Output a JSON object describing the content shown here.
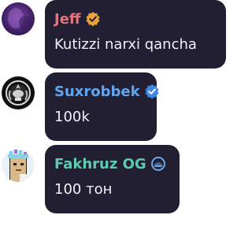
{
  "messages": [
    {
      "sender": "Jeff",
      "sender_color": "#e8737f",
      "badge_icon": "verified-gold-icon",
      "badge_color": "#e9a23b",
      "text": "Kutizzi narxi qancha",
      "avatar": "purple-blur-avatar"
    },
    {
      "sender": "Suxrobbek",
      "sender_color": "#5ea7f0",
      "badge_icon": "verified-blue-icon",
      "badge_color": "#3d8ae6",
      "text": "100k",
      "avatar": "emblem-avatar"
    },
    {
      "sender": "Fakhruz OG",
      "sender_color": "#5ccbb0",
      "badge_icon": "blue-helmet-icon",
      "badge_color": "#6aa7ea",
      "text": "100 тон",
      "avatar": "pixel-punk-avatar"
    }
  ],
  "colors": {
    "bubble_bg": "#231f32",
    "text": "#f2f2f7",
    "page_bg": "#ffffff"
  }
}
